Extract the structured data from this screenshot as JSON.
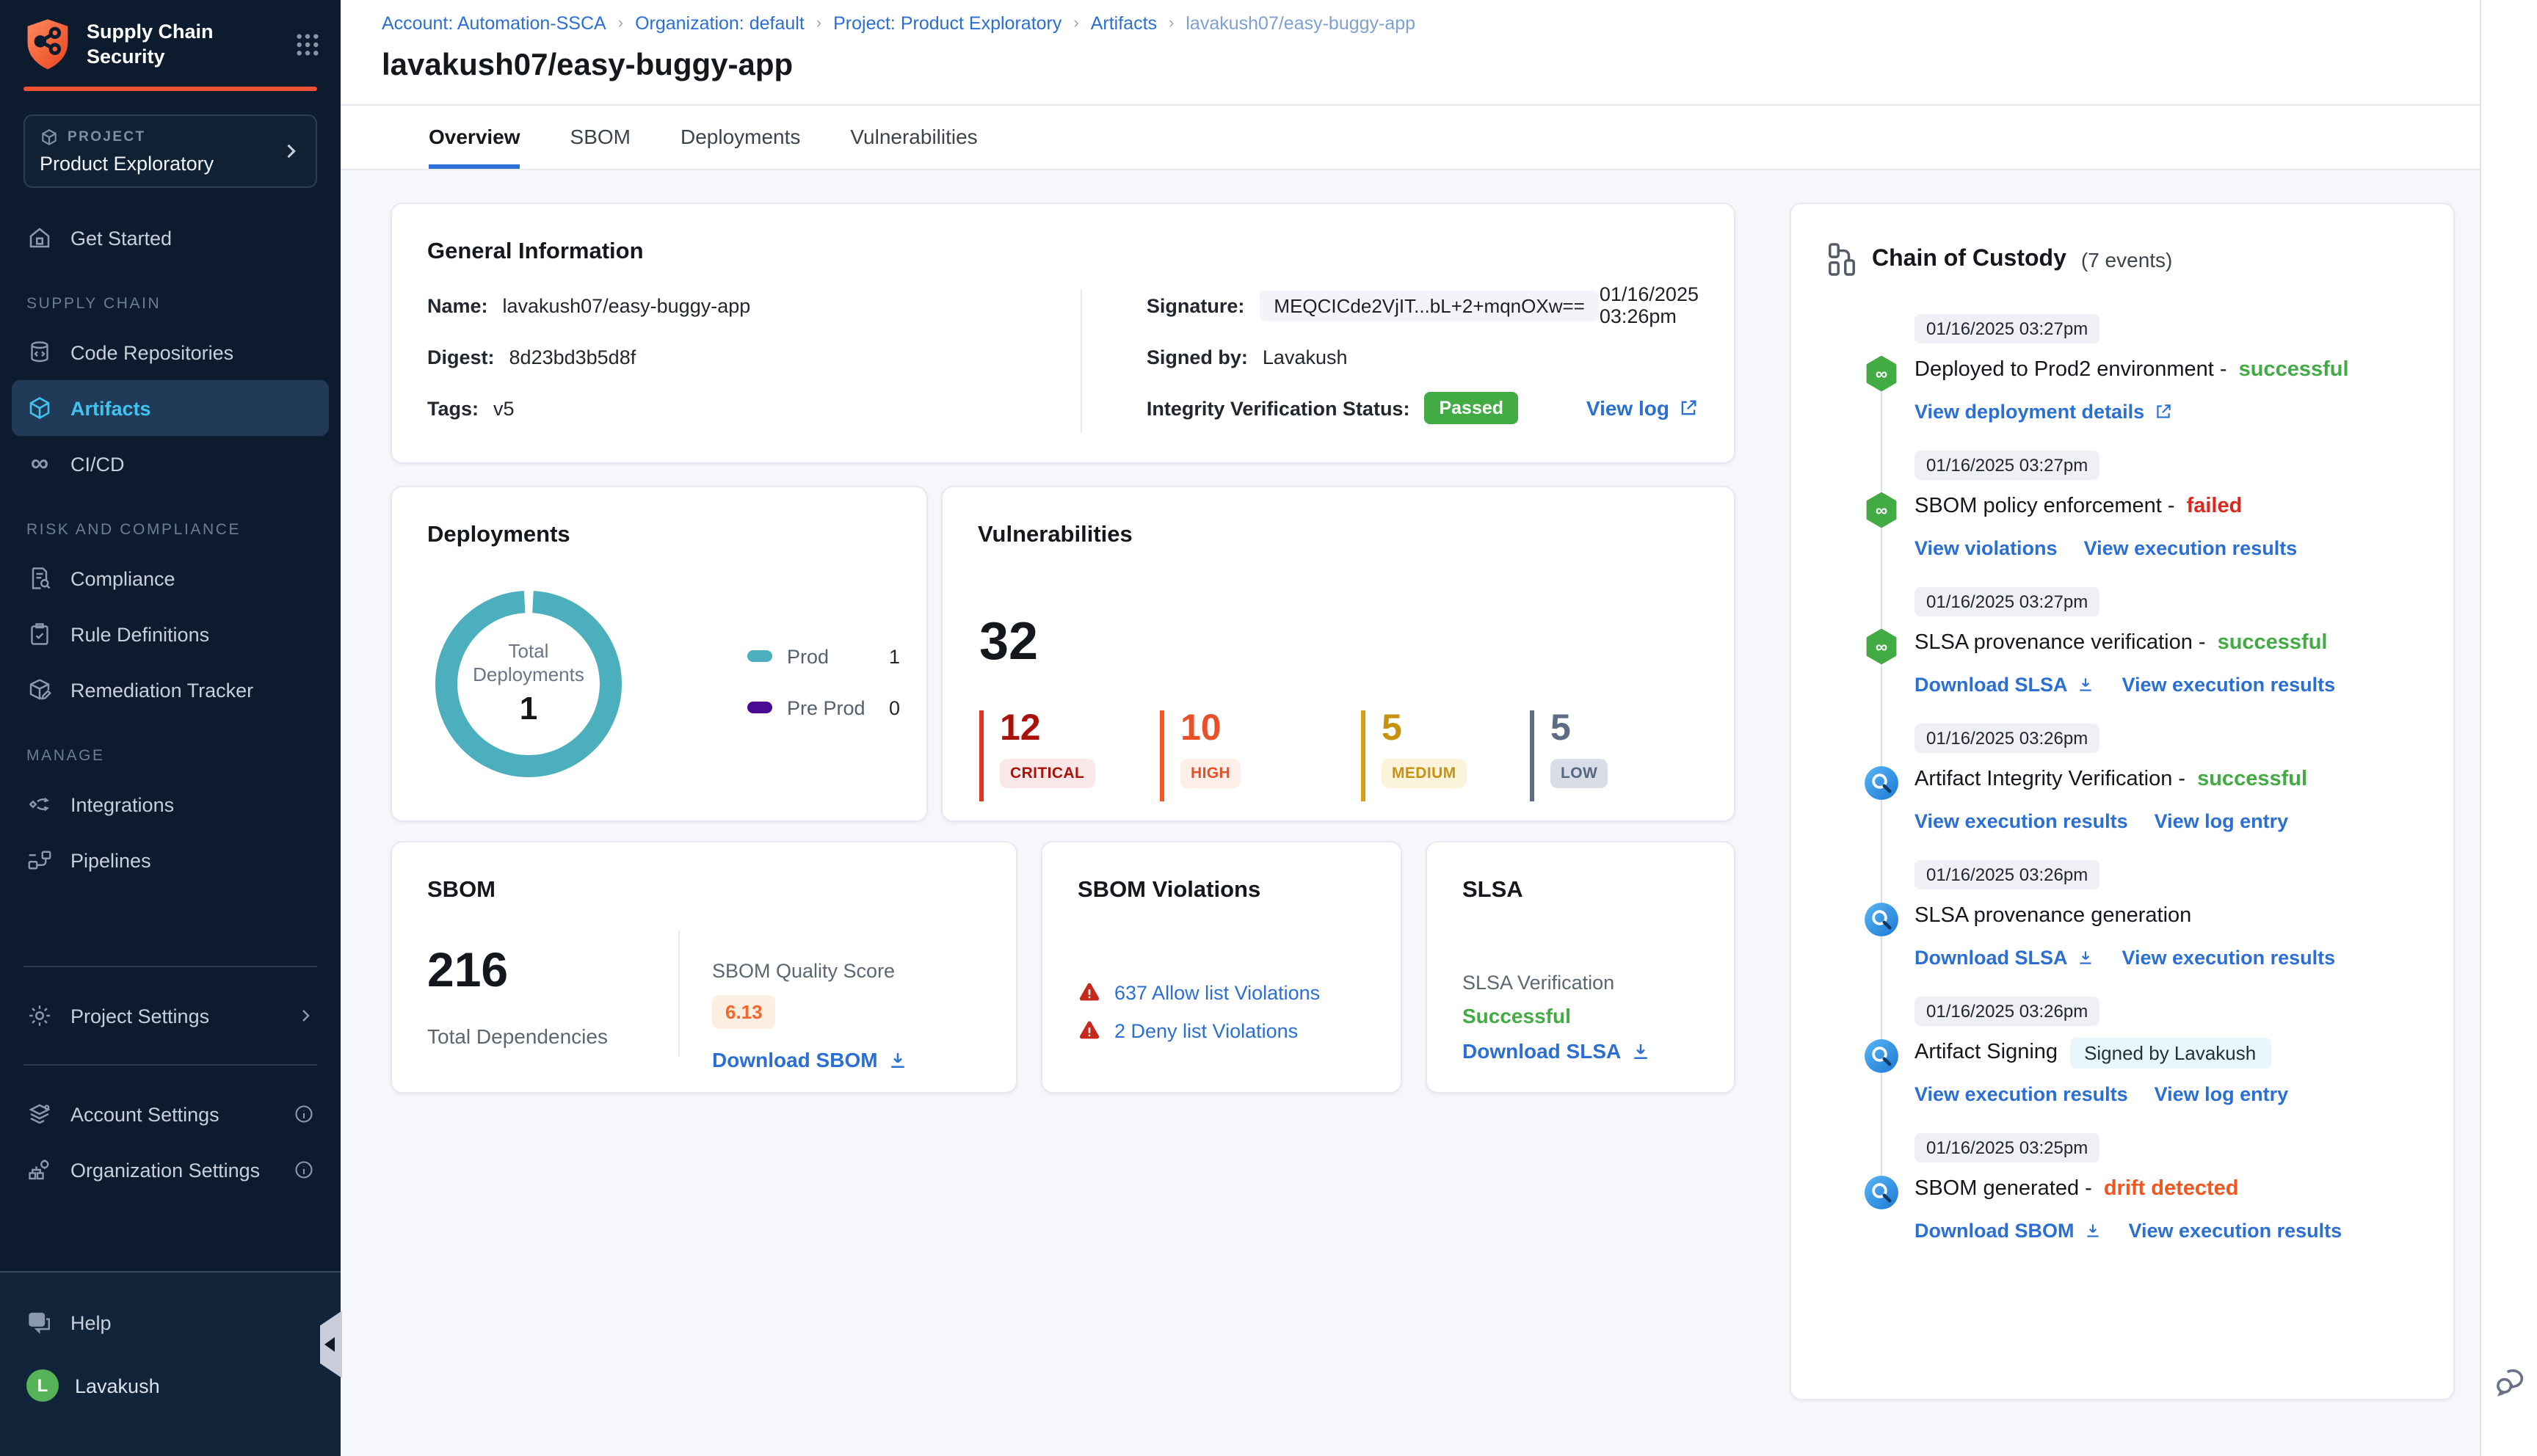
{
  "colors": {
    "brand_orange": "#EE5034",
    "link_blue": "#2B6FD4",
    "nav_active_blue": "#3FC4F2",
    "success_green": "#43AB44",
    "fail_red": "#DA291C",
    "drift_orange": "#F4551F",
    "donut_teal": "#4BAFBE",
    "preprod_purple": "#4B0A92",
    "critical": "#A8120B",
    "high": "#E8502A",
    "medium": "#C9920E",
    "low": "#5D6B84"
  },
  "icons": {
    "app_logo": "shield-network",
    "app_switcher": "nine-dot-grid",
    "project": "cube",
    "chain_of_custody": "branch-nodes",
    "pipeline_event": "green-hexagon-infinity",
    "ssca_event": "blue-circle-magnifier",
    "warning": "red-triangle-exclamation",
    "download": "arrow-down-tray",
    "external": "box-arrow-up-right",
    "chat": "speech-bubbles"
  },
  "sidebar": {
    "app_title": "Supply Chain Security",
    "project_label": "PROJECT",
    "project_name": "Product Exploratory",
    "items": {
      "get_started": "Get Started",
      "supply_chain_section": "SUPPLY CHAIN",
      "code_repositories": "Code Repositories",
      "artifacts": "Artifacts",
      "cicd": "CI/CD",
      "risk_section": "RISK AND COMPLIANCE",
      "compliance": "Compliance",
      "rule_definitions": "Rule Definitions",
      "remediation_tracker": "Remediation Tracker",
      "manage_section": "MANAGE",
      "integrations": "Integrations",
      "pipelines": "Pipelines",
      "project_settings": "Project Settings",
      "account_settings": "Account Settings",
      "organization_settings": "Organization Settings",
      "help": "Help"
    },
    "user": {
      "name": "Lavakush",
      "initial": "L"
    }
  },
  "header": {
    "breadcrumb": {
      "account": "Account: Automation-SSCA",
      "organization": "Organization: default",
      "project": "Project: Product Exploratory",
      "artifacts": "Artifacts",
      "current": "lavakush07/easy-buggy-app"
    },
    "title": "lavakush07/easy-buggy-app",
    "tabs": {
      "overview": "Overview",
      "sbom": "SBOM",
      "deployments": "Deployments",
      "vulnerabilities": "Vulnerabilities"
    }
  },
  "general_info": {
    "title": "General Information",
    "name_label": "Name:",
    "name_value": "lavakush07/easy-buggy-app",
    "digest_label": "Digest:",
    "digest_value": "8d23bd3b5d8f",
    "tags_label": "Tags:",
    "tags_value": "v5",
    "signature_label": "Signature:",
    "signature_value": "MEQCICde2VjIT...bL+2+mqnOXw==",
    "signature_time": "01/16/2025 03:26pm",
    "signed_by_label": "Signed by:",
    "signed_by_value": "Lavakush",
    "integrity_label": "Integrity Verification Status:",
    "integrity_status": "Passed",
    "view_log": "View log"
  },
  "deployments": {
    "title": "Deployments",
    "center_label": "Total Deployments",
    "total": "1",
    "legend": [
      {
        "label": "Prod",
        "value": "1",
        "color": "#4BAFBE"
      },
      {
        "label": "Pre Prod",
        "value": "0",
        "color": "#4B0A92"
      }
    ]
  },
  "vulnerabilities": {
    "title": "Vulnerabilities",
    "total": "32",
    "severities": [
      {
        "count": "12",
        "label": "CRITICAL",
        "text": "#A8120B",
        "bar": "#E1361F",
        "chip_bg": "#F9E8E7"
      },
      {
        "count": "10",
        "label": "HIGH",
        "text": "#E8502A",
        "bar": "#F25822",
        "chip_bg": "#FDEFE7"
      },
      {
        "count": "5",
        "label": "MEDIUM",
        "text": "#C9920E",
        "bar": "#D99E17",
        "chip_bg": "#FBF3DA"
      },
      {
        "count": "5",
        "label": "LOW",
        "text": "#5D6B84",
        "bar": "#5D6B84",
        "chip_bg": "#D9DDE7"
      }
    ]
  },
  "sbom": {
    "title": "SBOM",
    "total": "216",
    "total_label": "Total Dependencies",
    "score_label": "SBOM Quality Score",
    "score": "6.13",
    "download": "Download SBOM"
  },
  "sbom_violations": {
    "title": "SBOM Violations",
    "allow": "637 Allow list Violations",
    "deny": "2 Deny list Violations"
  },
  "slsa": {
    "title": "SLSA",
    "verification_label": "SLSA Verification",
    "status": "Successful",
    "download": "Download SLSA"
  },
  "chain_of_custody": {
    "title": "Chain of Custody",
    "count": "(7 events)",
    "events": [
      {
        "time": "01/16/2025 03:27pm",
        "title": "Deployed to Prod2 environment -",
        "status": "successful",
        "links": [
          {
            "label": "View deployment details"
          }
        ]
      },
      {
        "time": "01/16/2025 03:27pm",
        "title": "SBOM policy enforcement -",
        "status": "failed",
        "links": [
          {
            "label": "View violations"
          },
          {
            "label": "View execution results"
          }
        ]
      },
      {
        "time": "01/16/2025 03:27pm",
        "title": "SLSA provenance verification -",
        "status": "successful",
        "links": [
          {
            "label": "Download SLSA"
          },
          {
            "label": "View execution results"
          }
        ]
      },
      {
        "time": "01/16/2025 03:26pm",
        "title": "Artifact Integrity Verification -",
        "status": "successful",
        "links": [
          {
            "label": "View execution results"
          },
          {
            "label": "View log entry"
          }
        ]
      },
      {
        "time": "01/16/2025 03:26pm",
        "title": "SLSA provenance generation",
        "status": "",
        "links": [
          {
            "label": "Download SLSA"
          },
          {
            "label": "View execution results"
          }
        ]
      },
      {
        "time": "01/16/2025 03:26pm",
        "title": "Artifact Signing",
        "status": "",
        "chip": "Signed by Lavakush",
        "links": [
          {
            "label": "View execution results"
          },
          {
            "label": "View log entry"
          }
        ]
      },
      {
        "time": "01/16/2025 03:25pm",
        "title": "SBOM generated -",
        "status": "drift detected",
        "links": [
          {
            "label": "Download SBOM"
          },
          {
            "label": "View execution results"
          }
        ]
      }
    ]
  }
}
